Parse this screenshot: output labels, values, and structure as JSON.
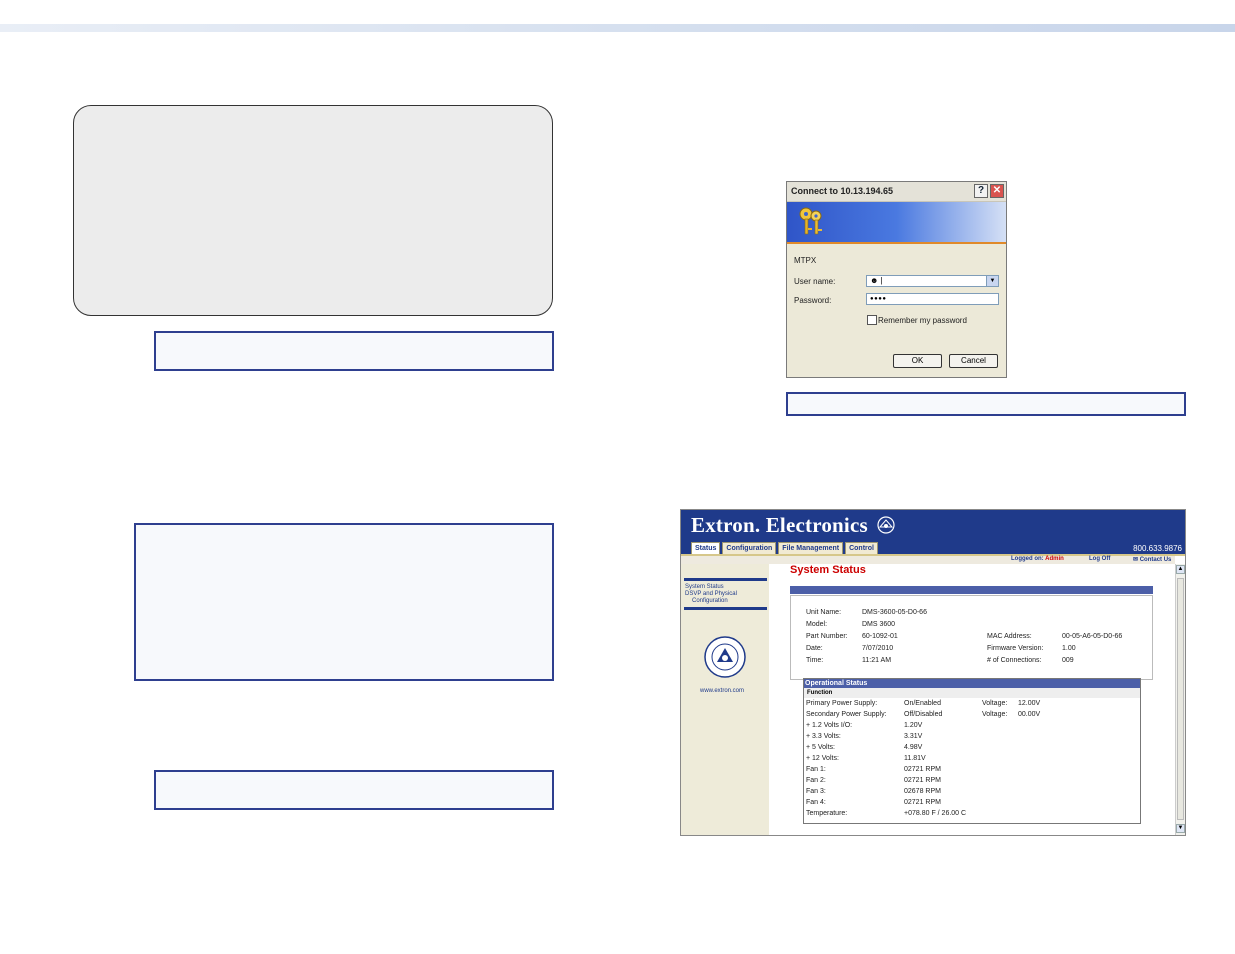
{
  "dialog": {
    "title": "Connect to 10.13.194.65",
    "help": "?",
    "close": "✕",
    "realm": "MTPX",
    "username_label": "User name:",
    "username_value": "|",
    "password_label": "Password:",
    "password_value": "●●●●",
    "remember_label": "Remember my password",
    "ok_label": "OK",
    "cancel_label": "Cancel"
  },
  "extron": {
    "brand": "Extron. Electronics",
    "phone": "800.633.9876",
    "tabs": [
      "Status",
      "Configuration",
      "File Management",
      "Control"
    ],
    "logged_on_label": "Logged on:",
    "logged_on_user": "Admin",
    "log_off": "Log Off",
    "contact_us": "Contact Us",
    "sidebar": {
      "link1": "System Status",
      "link2": "DSVP and Physical",
      "link3": "Configuration",
      "url": "www.extron.com"
    },
    "page_title": "System Status",
    "system": {
      "unit_name_label": "Unit Name:",
      "unit_name": "DMS-3600-05-D0-66",
      "model_label": "Model:",
      "model": "DMS 3600",
      "part_label": "Part Number:",
      "part": "60-1092-01",
      "date_label": "Date:",
      "date": "7/07/2010",
      "time_label": "Time:",
      "time": "11:21 AM",
      "mac_label": "MAC Address:",
      "mac": "00-05-A6-05-D0-66",
      "fw_label": "Firmware Version:",
      "fw": "1.00",
      "conn_label": "# of Connections:",
      "conn": "009"
    },
    "operational": {
      "header": "Operational Status",
      "function_header": "Function",
      "rows": [
        {
          "label": "Primary Power Supply:",
          "value": "On/Enabled",
          "extra_label": "Voltage:",
          "extra_value": "12.00V"
        },
        {
          "label": "Secondary Power Supply:",
          "value": "Off/Disabled",
          "extra_label": "Voltage:",
          "extra_value": "00.00V"
        },
        {
          "label": "+ 1.2 Volts I/O:",
          "value": "1.20V"
        },
        {
          "label": "+ 3.3 Volts:",
          "value": "3.31V"
        },
        {
          "label": "+ 5 Volts:",
          "value": "4.98V"
        },
        {
          "label": "+ 12 Volts:",
          "value": "11.81V"
        },
        {
          "label": "Fan 1:",
          "value": "02721 RPM"
        },
        {
          "label": "Fan 2:",
          "value": "02721 RPM"
        },
        {
          "label": "Fan 3:",
          "value": "02678 RPM"
        },
        {
          "label": "Fan 4:",
          "value": "02721 RPM"
        },
        {
          "label": "Temperature:",
          "value": "+078.80 F / 26.00 C"
        }
      ]
    }
  }
}
